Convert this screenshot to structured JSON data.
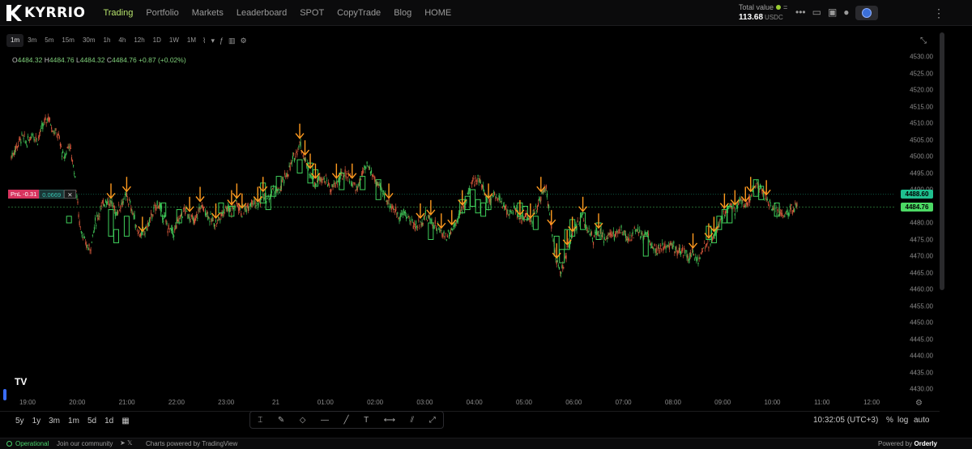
{
  "brand": {
    "name": "KYRRIO"
  },
  "nav": [
    "Trading",
    "Portfolio",
    "Markets",
    "Leaderboard",
    "SPOT",
    "CopyTrade",
    "Blog",
    "HOME"
  ],
  "active_nav": 0,
  "account": {
    "total_label": "Total value",
    "total_value": "113.68",
    "unit": "USDC"
  },
  "timeframes": [
    "1m",
    "3m",
    "5m",
    "15m",
    "30m",
    "1h",
    "4h",
    "12h",
    "1D",
    "1W",
    "1M"
  ],
  "active_timeframe": 0,
  "ohlc": {
    "o": "4484.32",
    "h": "4484.76",
    "l": "4484.32",
    "c": "4484.76",
    "change": "+0.87 (+0.02%)"
  },
  "pnl": {
    "label": "PnL -0.31",
    "qty": "0.0669",
    "close": "✕"
  },
  "chart_data": {
    "type": "candlestick",
    "symbol_unit": "USD",
    "ylim": [
      4430,
      4530
    ],
    "price_ticks": [
      "4530.00",
      "4525.00",
      "4520.00",
      "4515.00",
      "4510.00",
      "4505.00",
      "4500.00",
      "4495.00",
      "4490.00",
      "4485.00",
      "4480.00",
      "4475.00",
      "4470.00",
      "4465.00",
      "4460.00",
      "4455.00",
      "4450.00",
      "4445.00",
      "4440.00",
      "4435.00",
      "4430.00"
    ],
    "time_ticks": [
      "19:00",
      "20:00",
      "21:00",
      "22:00",
      "23:00",
      "21",
      "01:00",
      "02:00",
      "03:00",
      "04:00",
      "05:00",
      "06:00",
      "07:00",
      "08:00",
      "09:00",
      "10:00",
      "11:00",
      "12:00"
    ],
    "price_path": [
      [
        0,
        4500
      ],
      [
        1,
        4503
      ],
      [
        2,
        4506
      ],
      [
        3,
        4504
      ],
      [
        4,
        4507
      ],
      [
        5,
        4505
      ],
      [
        6,
        4509
      ],
      [
        7,
        4512
      ],
      [
        8,
        4508
      ],
      [
        9,
        4506
      ],
      [
        10,
        4499
      ],
      [
        11,
        4504
      ],
      [
        12,
        4496
      ],
      [
        13,
        4480
      ],
      [
        14,
        4474
      ],
      [
        15,
        4472
      ],
      [
        16,
        4480
      ],
      [
        17,
        4484
      ],
      [
        18,
        4487
      ],
      [
        19,
        4486
      ],
      [
        20,
        4483
      ],
      [
        21,
        4486
      ],
      [
        22,
        4488
      ],
      [
        23,
        4484
      ],
      [
        24,
        4478
      ],
      [
        25,
        4476
      ],
      [
        26,
        4479
      ],
      [
        27,
        4483
      ],
      [
        28,
        4486
      ],
      [
        29,
        4482
      ],
      [
        30,
        4478
      ],
      [
        31,
        4477
      ],
      [
        32,
        4481
      ],
      [
        33,
        4484
      ],
      [
        34,
        4482
      ],
      [
        35,
        4480
      ],
      [
        36,
        4485
      ],
      [
        37,
        4484
      ],
      [
        38,
        4481
      ],
      [
        39,
        4480
      ],
      [
        40,
        4482
      ],
      [
        41,
        4485
      ],
      [
        42,
        4484
      ],
      [
        43,
        4486
      ],
      [
        44,
        4483
      ],
      [
        45,
        4485
      ],
      [
        46,
        4487
      ],
      [
        47,
        4485
      ],
      [
        48,
        4488
      ],
      [
        49,
        4487
      ],
      [
        50,
        4490
      ],
      [
        51,
        4489
      ],
      [
        52,
        4493
      ],
      [
        53,
        4496
      ],
      [
        54,
        4500
      ],
      [
        55,
        4504
      ],
      [
        56,
        4499
      ],
      [
        57,
        4495
      ],
      [
        58,
        4492
      ],
      [
        59,
        4494
      ],
      [
        60,
        4493
      ],
      [
        61,
        4490
      ],
      [
        62,
        4492
      ],
      [
        63,
        4494
      ],
      [
        64,
        4495
      ],
      [
        65,
        4492
      ],
      [
        66,
        4490
      ],
      [
        67,
        4495
      ],
      [
        68,
        4497
      ],
      [
        69,
        4494
      ],
      [
        70,
        4491
      ],
      [
        71,
        4489
      ],
      [
        72,
        4486
      ],
      [
        73,
        4484
      ],
      [
        74,
        4482
      ],
      [
        75,
        4483
      ],
      [
        76,
        4481
      ],
      [
        77,
        4479
      ],
      [
        78,
        4480
      ],
      [
        79,
        4482
      ],
      [
        80,
        4481
      ],
      [
        81,
        4479
      ],
      [
        82,
        4477
      ],
      [
        83,
        4476
      ],
      [
        84,
        4478
      ],
      [
        85,
        4481
      ],
      [
        86,
        4484
      ],
      [
        87,
        4488
      ],
      [
        88,
        4492
      ],
      [
        89,
        4494
      ],
      [
        90,
        4490
      ],
      [
        91,
        4486
      ],
      [
        92,
        4489
      ],
      [
        93,
        4487
      ],
      [
        94,
        4485
      ],
      [
        95,
        4483
      ],
      [
        96,
        4484
      ],
      [
        97,
        4481
      ],
      [
        98,
        4482
      ],
      [
        99,
        4480
      ],
      [
        100,
        4484
      ],
      [
        101,
        4488
      ],
      [
        102,
        4491
      ],
      [
        103,
        4478
      ],
      [
        104,
        4468
      ],
      [
        105,
        4465
      ],
      [
        106,
        4472
      ],
      [
        107,
        4476
      ],
      [
        108,
        4480
      ],
      [
        109,
        4482
      ],
      [
        110,
        4478
      ],
      [
        111,
        4475
      ],
      [
        112,
        4477
      ],
      [
        113,
        4475
      ],
      [
        114,
        4477
      ],
      [
        115,
        4476
      ],
      [
        116,
        4478
      ],
      [
        117,
        4476
      ],
      [
        118,
        4475
      ],
      [
        119,
        4478
      ],
      [
        120,
        4476
      ],
      [
        121,
        4477
      ],
      [
        122,
        4474
      ],
      [
        123,
        4472
      ],
      [
        124,
        4473
      ],
      [
        125,
        4472
      ],
      [
        126,
        4474
      ],
      [
        127,
        4471
      ],
      [
        128,
        4472
      ],
      [
        129,
        4470
      ],
      [
        130,
        4471
      ],
      [
        131,
        4469
      ],
      [
        132,
        4472
      ],
      [
        133,
        4474
      ],
      [
        134,
        4476
      ],
      [
        135,
        4480
      ],
      [
        136,
        4483
      ],
      [
        137,
        4486
      ],
      [
        138,
        4484
      ],
      [
        139,
        4487
      ],
      [
        140,
        4485
      ],
      [
        141,
        4488
      ],
      [
        142,
        4492
      ],
      [
        143,
        4490
      ],
      [
        144,
        4487
      ],
      [
        145,
        4485
      ],
      [
        146,
        4484
      ],
      [
        147,
        4482
      ],
      [
        148,
        4483
      ],
      [
        149,
        4484
      ],
      [
        150,
        4484.76
      ]
    ],
    "highlight_candles": [
      [
        11,
        4480,
        4482
      ],
      [
        19,
        4476,
        4484
      ],
      [
        20,
        4474,
        4478
      ],
      [
        22,
        4476,
        4482
      ],
      [
        29,
        4482,
        4486
      ],
      [
        32,
        4480,
        4484
      ],
      [
        40,
        4483,
        4486
      ],
      [
        42,
        4482,
        4485
      ],
      [
        48,
        4486,
        4492
      ],
      [
        49,
        4484,
        4488
      ],
      [
        50,
        4488,
        4491
      ],
      [
        51,
        4490,
        4494
      ],
      [
        55,
        4495,
        4499
      ],
      [
        57,
        4492,
        4498
      ],
      [
        58,
        4491,
        4496
      ],
      [
        63,
        4490,
        4495
      ],
      [
        67,
        4490,
        4494
      ],
      [
        70,
        4487,
        4493
      ],
      [
        80,
        4475,
        4480
      ],
      [
        86,
        4483,
        4487
      ],
      [
        87,
        4484,
        4488
      ],
      [
        88,
        4485,
        4490
      ],
      [
        89,
        4483,
        4487
      ],
      [
        90,
        4482,
        4486
      ],
      [
        91,
        4484,
        4488
      ],
      [
        97,
        4482,
        4486
      ],
      [
        98,
        4481,
        4485
      ],
      [
        100,
        4478,
        4482
      ],
      [
        104,
        4470,
        4476
      ],
      [
        105,
        4468,
        4472
      ],
      [
        106,
        4472,
        4478
      ],
      [
        107,
        4476,
        4481
      ],
      [
        109,
        4478,
        4483
      ],
      [
        112,
        4475,
        4480
      ],
      [
        121,
        4470,
        4476
      ],
      [
        133,
        4475,
        4479
      ],
      [
        134,
        4474,
        4478
      ],
      [
        135,
        4478,
        4482
      ],
      [
        136,
        4480,
        4484
      ],
      [
        137,
        4480,
        4485
      ],
      [
        142,
        4488,
        4493
      ],
      [
        143,
        4487,
        4491
      ],
      [
        146,
        4482,
        4486
      ]
    ],
    "arrow_markers": [
      19,
      22,
      25,
      34,
      36,
      39,
      42,
      43,
      44,
      47,
      48,
      55,
      56,
      57,
      58,
      62,
      65,
      72,
      78,
      80,
      82,
      84,
      86,
      91,
      97,
      99,
      101,
      103,
      104,
      106,
      107,
      109,
      112,
      130,
      133,
      134,
      136,
      138,
      140,
      141,
      144
    ],
    "horizontal_lines": [
      {
        "value": 4488.6,
        "label": "4488.60",
        "color": "#1fbf8f"
      },
      {
        "value": 4484.76,
        "label": "4484.76",
        "color": "#4cd964"
      }
    ],
    "grid": false
  },
  "bottom": {
    "ranges": [
      "5y",
      "1y",
      "3m",
      "1m",
      "5d",
      "1d"
    ],
    "clock": "10:32:05 (UTC+3)",
    "options": [
      "%",
      "log",
      "auto"
    ]
  },
  "status": {
    "operational": "Operational",
    "community": "Join our community",
    "charts_powered": "Charts powered by TradingView",
    "powered_by": "Powered by",
    "powered_brand": "Orderly"
  },
  "tv_logo": "TV"
}
